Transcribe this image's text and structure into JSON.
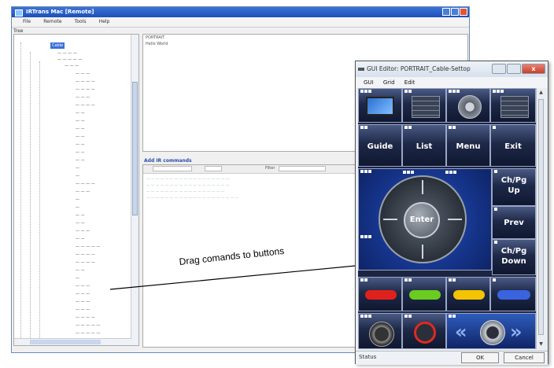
{
  "main_window": {
    "title": "IRTrans Mac [Remote]",
    "menu": [
      "File",
      "Remote",
      "Tools",
      "Help"
    ],
    "tree_label": "Tree",
    "right_top_title": "PORTRAIT",
    "right_top_sub": "Hello World",
    "splitter_label": "Add IR commands",
    "filter_label": "Filter",
    "tree_selected": "Cable"
  },
  "annotation": {
    "text": "Drag comands to buttons"
  },
  "gui_editor": {
    "title": "GUI Editor: PORTRAIT_Cable-Settop",
    "menu": [
      "GUI",
      "Grid",
      "Edit"
    ],
    "buttons": {
      "guide": "Guide",
      "list": "List",
      "menu": "Menu",
      "exit": "Exit",
      "ch_up": "Ch/Pg\nUp",
      "prev": "Prev",
      "ch_down": "Ch/Pg\nDown",
      "enter": "Enter"
    },
    "colors": {
      "red": "#e0201c",
      "green": "#6acc1e",
      "yellow": "#f5c400",
      "blue": "#3a63e0",
      "canvas": "#1b2440"
    },
    "status": {
      "label": "Status",
      "ok": "OK",
      "cancel": "Cancel"
    }
  }
}
